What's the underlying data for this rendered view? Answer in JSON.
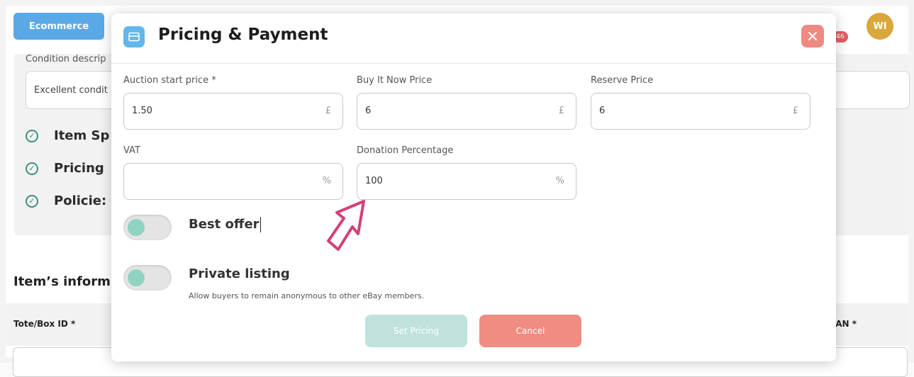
{
  "background": {
    "ecommerce_button": "Ecommerce",
    "avatar_initials": "WI",
    "notification_count": "46",
    "condition_label": "Condition descrip",
    "condition_value": "Excellent condit",
    "checklist": [
      "Item Sp",
      "Pricing",
      "Policie:"
    ],
    "section_title": "Item’s inform",
    "table_headers": {
      "tote": "Tote/Box ID *",
      "ean": "EAN *"
    }
  },
  "modal": {
    "title": "Pricing & Payment",
    "fields": {
      "auction_start": {
        "label": "Auction start price *",
        "value": "1.50",
        "unit": "£"
      },
      "buy_it_now": {
        "label": "Buy It Now Price",
        "value": "6",
        "unit": "£"
      },
      "reserve": {
        "label": "Reserve Price",
        "value": "6",
        "unit": "£"
      },
      "vat": {
        "label": "VAT",
        "value": "",
        "unit": "%"
      },
      "donation": {
        "label": "Donation Percentage",
        "value": "100",
        "unit": "%"
      }
    },
    "toggles": {
      "best_offer": {
        "label": "Best offer",
        "state": "off"
      },
      "private_listing": {
        "label": "Private listing",
        "state": "off",
        "description": "Allow buyers to remain anonymous to other eBay members."
      }
    },
    "buttons": {
      "set_pricing": "Set Pricing",
      "cancel": "Cancel"
    }
  },
  "colors": {
    "accent_blue": "#62b7ea",
    "close_red": "#ef8a82",
    "toggle_knob": "#8fd3c3",
    "pointer": "#d43f7a"
  },
  "icons": [
    "card-icon",
    "close-icon",
    "check-circle-icon",
    "hand-pointer-icon"
  ]
}
